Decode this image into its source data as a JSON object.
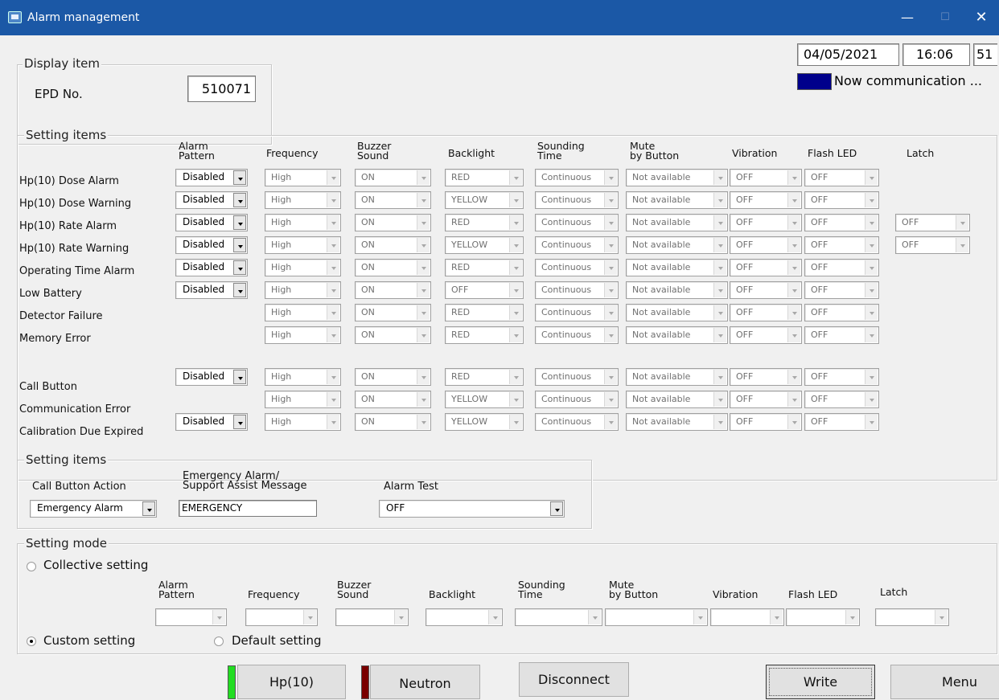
{
  "window": {
    "title": "Alarm management",
    "minimize": "—",
    "maximize": "☐",
    "close": "✕"
  },
  "status": {
    "date": "04/05/2021",
    "time": "16:06",
    "code": "51",
    "indicator_color": "#00008b",
    "comm_text": "Now communication ..."
  },
  "display": {
    "group_label": "Display item",
    "epd_label": "EPD No.",
    "epd_value": "510071"
  },
  "settings": {
    "group_label": "Setting items",
    "headers": {
      "alarm_pattern": "Alarm\nPattern",
      "frequency": "Frequency",
      "buzzer": "Buzzer\nSound",
      "backlight": "Backlight",
      "sounding_time": "Sounding\nTime",
      "mute": "Mute\nby Button",
      "vibration": "Vibration",
      "flash_led": "Flash LED",
      "latch": "Latch"
    },
    "rows": [
      {
        "label": "Hp(10) Dose Alarm",
        "pattern": "Disabled",
        "frequency": "High",
        "buzzer": "ON",
        "backlight": "RED",
        "time": "Continuous",
        "mute": "Not available",
        "vibration": "OFF",
        "flash": "OFF",
        "latch": ""
      },
      {
        "label": "Hp(10) Dose Warning",
        "pattern": "Disabled",
        "frequency": "High",
        "buzzer": "ON",
        "backlight": "YELLOW",
        "time": "Continuous",
        "mute": "Not available",
        "vibration": "OFF",
        "flash": "OFF",
        "latch": ""
      },
      {
        "label": "Hp(10) Rate Alarm",
        "pattern": "Disabled",
        "frequency": "High",
        "buzzer": "ON",
        "backlight": "RED",
        "time": "Continuous",
        "mute": "Not available",
        "vibration": "OFF",
        "flash": "OFF",
        "latch": "OFF"
      },
      {
        "label": "Hp(10) Rate Warning",
        "pattern": "Disabled",
        "frequency": "High",
        "buzzer": "ON",
        "backlight": "YELLOW",
        "time": "Continuous",
        "mute": "Not available",
        "vibration": "OFF",
        "flash": "OFF",
        "latch": "OFF"
      },
      {
        "label": "Operating Time Alarm",
        "pattern": "Disabled",
        "frequency": "High",
        "buzzer": "ON",
        "backlight": "RED",
        "time": "Continuous",
        "mute": "Not available",
        "vibration": "OFF",
        "flash": "OFF",
        "latch": ""
      },
      {
        "label": "Low Battery",
        "pattern": "Disabled",
        "frequency": "High",
        "buzzer": "ON",
        "backlight": "OFF",
        "time": "Continuous",
        "mute": "Not available",
        "vibration": "OFF",
        "flash": "OFF",
        "latch": ""
      },
      {
        "label": "Detector Failure",
        "pattern": "",
        "frequency": "High",
        "buzzer": "ON",
        "backlight": "RED",
        "time": "Continuous",
        "mute": "Not available",
        "vibration": "OFF",
        "flash": "OFF",
        "latch": ""
      },
      {
        "label": "Memory Error",
        "pattern": "",
        "frequency": "High",
        "buzzer": "ON",
        "backlight": "RED",
        "time": "Continuous",
        "mute": "Not available",
        "vibration": "OFF",
        "flash": "OFF",
        "latch": ""
      },
      {
        "label": "Call Button",
        "pattern": "Disabled",
        "frequency": "High",
        "buzzer": "ON",
        "backlight": "RED",
        "time": "Continuous",
        "mute": "Not available",
        "vibration": "OFF",
        "flash": "OFF",
        "latch": ""
      },
      {
        "label": "Communication Error",
        "pattern": "",
        "frequency": "High",
        "buzzer": "ON",
        "backlight": "YELLOW",
        "time": "Continuous",
        "mute": "Not available",
        "vibration": "OFF",
        "flash": "OFF",
        "latch": ""
      },
      {
        "label": "Calibration Due Expired",
        "pattern": "Disabled",
        "frequency": "High",
        "buzzer": "ON",
        "backlight": "YELLOW",
        "time": "Continuous",
        "mute": "Not available",
        "vibration": "OFF",
        "flash": "OFF",
        "latch": ""
      }
    ]
  },
  "settings2": {
    "group_label": "Setting items",
    "call_button_action_label": "Call Button Action",
    "call_button_action_value": "Emergency Alarm",
    "message_label": "Emergency Alarm/\nSupport Assist Message",
    "message_value": "EMERGENCY",
    "alarm_test_label": "Alarm Test",
    "alarm_test_value": "OFF"
  },
  "mode": {
    "group_label": "Setting mode",
    "collective": "Collective setting",
    "custom": "Custom setting",
    "default": "Default setting",
    "selected": "custom",
    "headers": {
      "alarm_pattern": "Alarm\nPattern",
      "frequency": "Frequency",
      "buzzer": "Buzzer\nSound",
      "backlight": "Backlight",
      "sounding_time": "Sounding\nTime",
      "mute": "Mute\nby Button",
      "vibration": "Vibration",
      "flash_led": "Flash LED",
      "latch": "Latch"
    }
  },
  "footer": {
    "hp10": "Hp(10)",
    "hp10_indicator_color": "#22dd22",
    "neutron": "Neutron",
    "neutron_indicator_color": "#7a0000",
    "disconnect": "Disconnect",
    "write": "Write",
    "menu": "Menu"
  }
}
